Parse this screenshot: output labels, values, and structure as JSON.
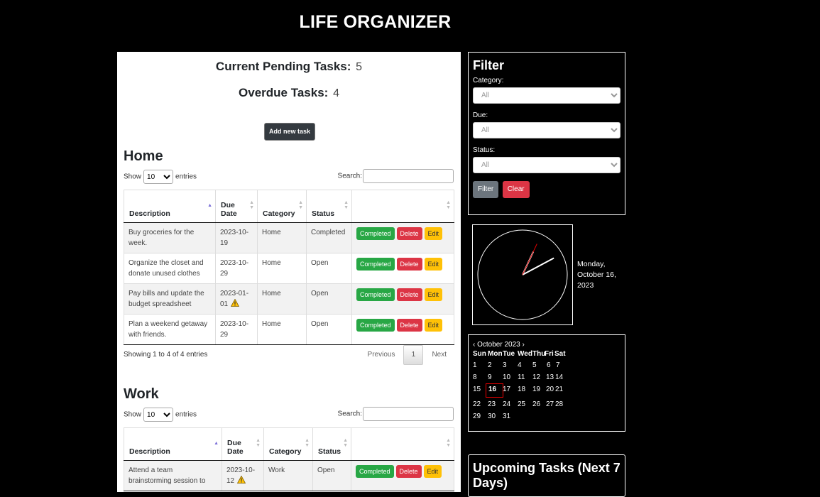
{
  "app": {
    "title": "LIFE ORGANIZER"
  },
  "stats": {
    "pending_label": "Current Pending Tasks:",
    "pending_value": "5",
    "overdue_label": "Overdue Tasks:",
    "overdue_value": "4"
  },
  "add_task_label": "Add new task",
  "table_columns": [
    "Description",
    "Due Date",
    "Category",
    "Status"
  ],
  "home": {
    "title": "Home",
    "show_label": "Show",
    "entries_label": "entries",
    "page_length": "10",
    "search_label": "Search:",
    "rows": [
      {
        "description": "Buy groceries for the week.",
        "due": "2023-10-19",
        "category": "Home",
        "status": "Completed",
        "overdue": false
      },
      {
        "description": "Organize the closet and donate unused clothes",
        "due": "2023-10-29",
        "category": "Home",
        "status": "Open",
        "overdue": false
      },
      {
        "description": "Pay bills and update the budget spreadsheet",
        "due": "2023-01-01",
        "category": "Home",
        "status": "Open",
        "overdue": true
      },
      {
        "description": "Plan a weekend getaway with friends.",
        "due": "2023-10-29",
        "category": "Home",
        "status": "Open",
        "overdue": false
      }
    ],
    "info": "Showing 1 to 4 of 4 entries",
    "previous": "Previous",
    "page": "1",
    "next": "Next"
  },
  "work": {
    "title": "Work",
    "show_label": "Show",
    "entries_label": "entries",
    "page_length": "10",
    "search_label": "Search:",
    "rows": [
      {
        "description": "Attend a team brainstorming session to",
        "due": "2023-10-12",
        "category": "Work",
        "status": "Open",
        "overdue": true
      }
    ]
  },
  "row_actions": {
    "completed": "Completed",
    "delete": "Delete",
    "edit": "Edit"
  },
  "filter": {
    "title": "Filter",
    "category_label": "Category:",
    "category_value": "All",
    "due_label": "Due:",
    "due_value": "All",
    "status_label": "Status:",
    "status_value": "All",
    "filter_button": "Filter",
    "clear_button": "Clear"
  },
  "clock": {
    "hour_angle_deg": 62,
    "minute_angle_deg": 25,
    "second_angle_deg": 25
  },
  "date_text": "Monday, October 16, 2023",
  "calendar": {
    "prev": "‹",
    "month_label": "October 2023",
    "next": "›",
    "weekdays": [
      "Sun",
      "Mon",
      "Tue",
      "Wed",
      "Thu",
      "Fri",
      "Sat"
    ],
    "weeks": [
      [
        "1",
        "2",
        "3",
        "4",
        "5",
        "6",
        "7"
      ],
      [
        "8",
        "9",
        "10",
        "11",
        "12",
        "13",
        "14"
      ],
      [
        "15",
        "16",
        "17",
        "18",
        "19",
        "20",
        "21"
      ],
      [
        "22",
        "23",
        "24",
        "25",
        "26",
        "27",
        "28"
      ],
      [
        "29",
        "30",
        "31",
        "",
        "",
        "",
        ""
      ]
    ],
    "today": "16"
  },
  "upcoming": {
    "title": "Upcoming Tasks (Next 7 Days)"
  },
  "colors": {
    "completed": "#28a745",
    "delete": "#dc3545",
    "edit": "#ffc107",
    "dark": "#343a40",
    "today_border": "#ee0000",
    "clock_red": "#e00000"
  }
}
